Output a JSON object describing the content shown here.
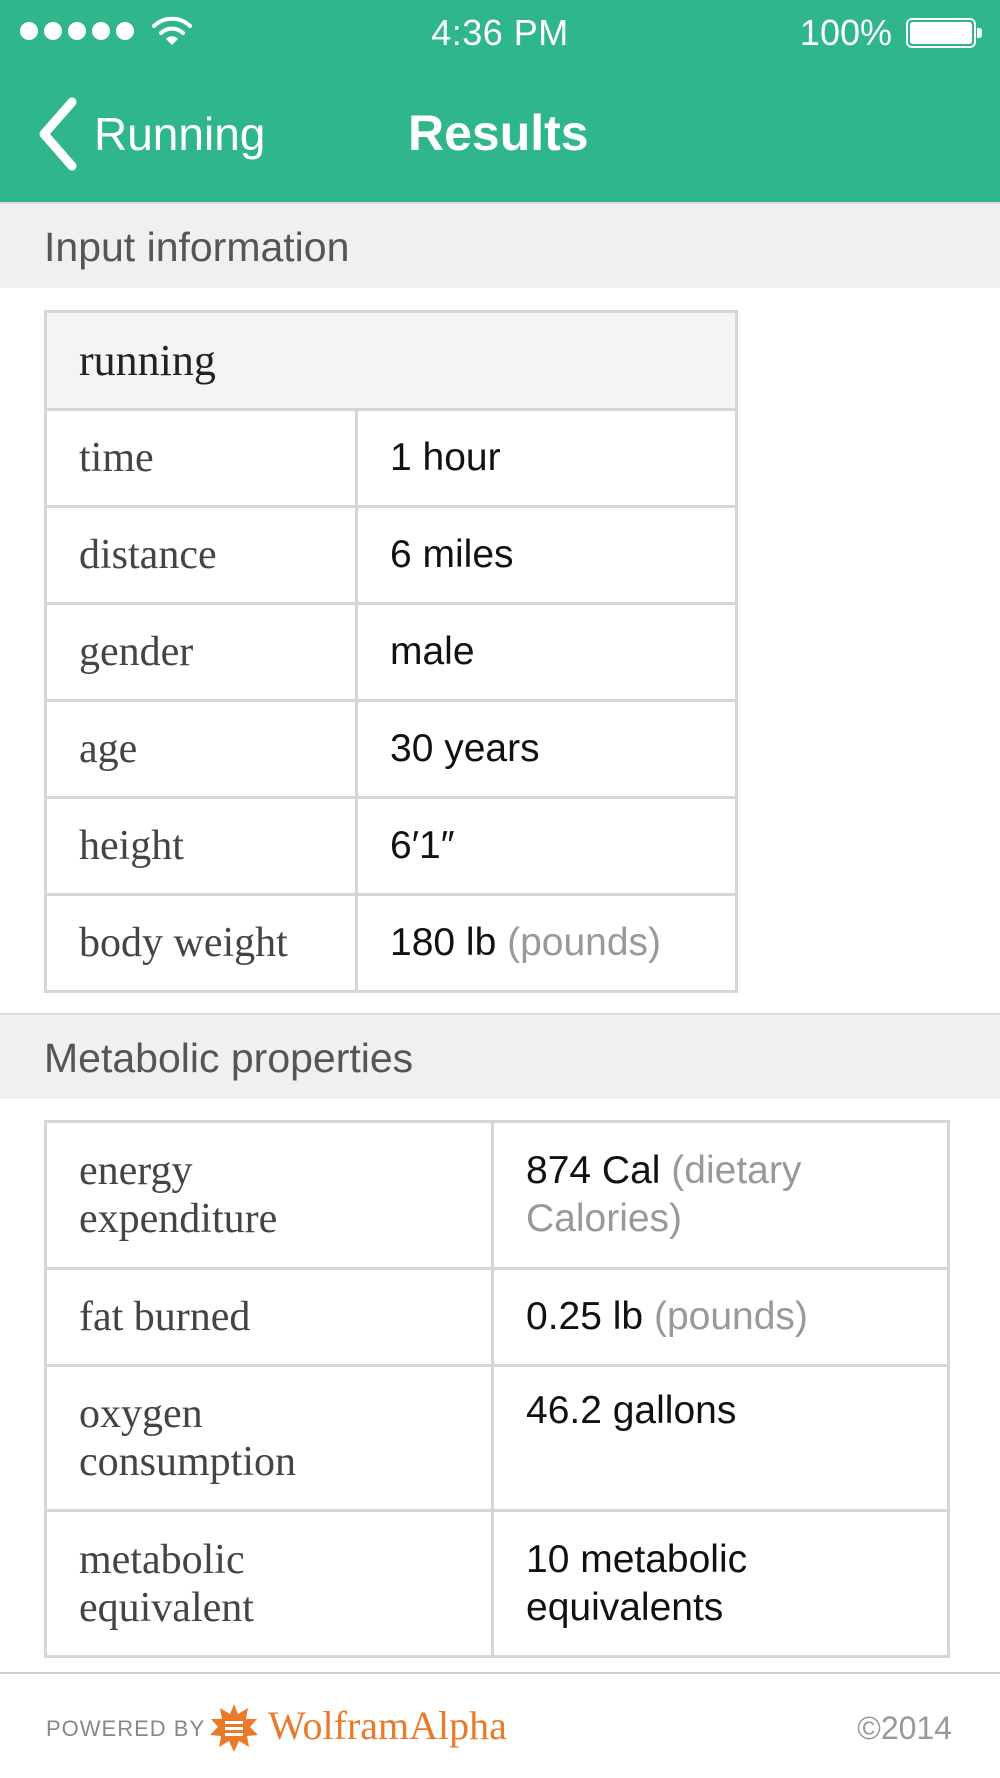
{
  "status_bar": {
    "time": "4:36 PM",
    "battery_percent": "100%"
  },
  "nav": {
    "back_label": "Running",
    "title": "Results"
  },
  "input_section": {
    "heading": "Input information",
    "table_title": "running",
    "rows": [
      {
        "label": "time",
        "value": "1 hour",
        "unit": ""
      },
      {
        "label": "distance",
        "value": "6 miles",
        "unit": ""
      },
      {
        "label": "gender",
        "value": "male",
        "unit": ""
      },
      {
        "label": "age",
        "value": "30 years",
        "unit": ""
      },
      {
        "label": "height",
        "value": "6′1″",
        "unit": ""
      },
      {
        "label": "body weight",
        "value": "180 lb",
        "unit": "(pounds)"
      }
    ]
  },
  "metabolic_section": {
    "heading": "Metabolic properties",
    "rows": [
      {
        "label_line1": "energy",
        "label_line2": "expenditure",
        "value_line1": "874 Cal",
        "value_unit1": "(dietary",
        "value_line2": "",
        "value_unit2": "Calories)"
      },
      {
        "label_line1": "fat burned",
        "label_line2": "",
        "value_line1": "0.25 lb",
        "value_unit1": "(pounds)",
        "value_line2": "",
        "value_unit2": ""
      },
      {
        "label_line1": "oxygen",
        "label_line2": "consumption",
        "value_line1": "46.2 gallons",
        "value_unit1": "",
        "value_line2": "",
        "value_unit2": ""
      },
      {
        "label_line1": "metabolic",
        "label_line2": "equivalent",
        "value_line1": "10 metabolic",
        "value_unit1": "",
        "value_line2": "equivalents",
        "value_unit2": ""
      }
    ]
  },
  "footer": {
    "powered_by": "POWERED BY",
    "brand": "WolframAlpha",
    "copyright": "©2014"
  },
  "colors": {
    "header_bg": "#2fb68c",
    "brand_orange": "#e97a2a"
  }
}
